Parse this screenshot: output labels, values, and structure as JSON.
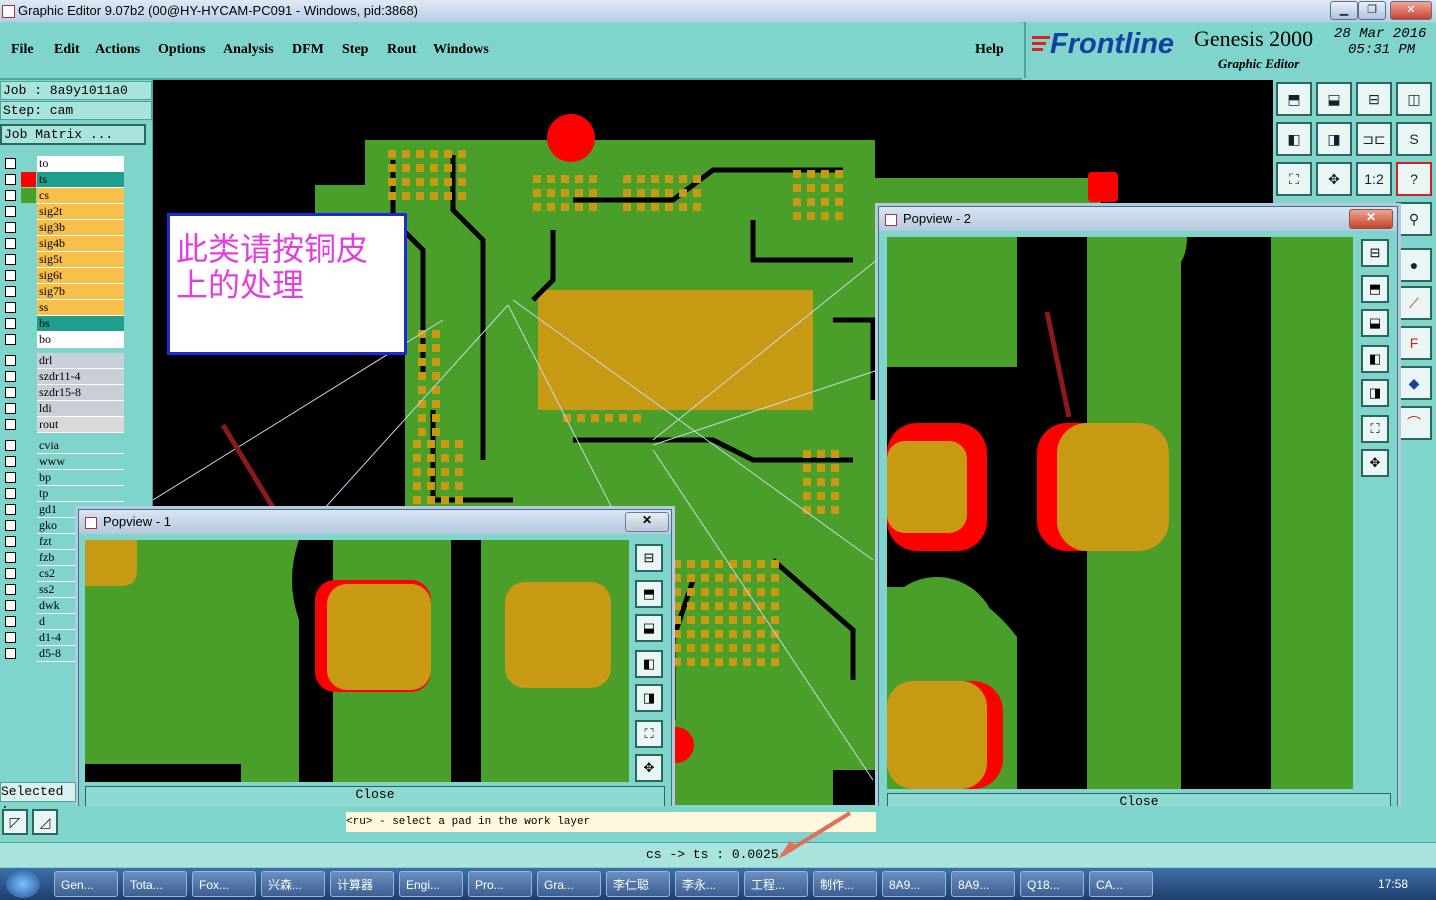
{
  "window": {
    "title": "Graphic Editor 9.07b2 (00@HY-HYCAM-PC091 - Windows, pid:3868)",
    "min": "▁",
    "max": "❐",
    "close": "✕"
  },
  "menu": {
    "items": [
      "File",
      "Edit",
      "Actions",
      "Options",
      "Analysis",
      "DFM",
      "Step",
      "Rout",
      "Windows"
    ],
    "help": "Help"
  },
  "brand": {
    "logo": "Frontline",
    "product": "Genesis 2000",
    "subtitle": "Graphic Editor",
    "date": "28 Mar 2016",
    "time": "05:31 PM"
  },
  "job": {
    "job_label": "Job : 8a9y1011a0",
    "step_label": "Step: cam",
    "matrix_button": "Job Matrix ..."
  },
  "layers": {
    "group1": [
      {
        "name": "to",
        "color": "#ffffff",
        "swatch": "#7fd4cc"
      },
      {
        "name": "ts",
        "color": "#1f9e8e",
        "swatch": "#ff0000",
        "active": true
      },
      {
        "name": "cs",
        "color": "#f6c04a",
        "swatch": "#4a9e2a"
      },
      {
        "name": "sig2t",
        "color": "#f6c04a",
        "swatch": "#7fd4cc"
      },
      {
        "name": "sig3b",
        "color": "#f6c04a",
        "swatch": "#7fd4cc"
      },
      {
        "name": "sig4b",
        "color": "#f6c04a",
        "swatch": "#7fd4cc"
      },
      {
        "name": "sig5t",
        "color": "#f6c04a",
        "swatch": "#7fd4cc"
      },
      {
        "name": "sig6t",
        "color": "#f6c04a",
        "swatch": "#7fd4cc"
      },
      {
        "name": "sig7b",
        "color": "#f6c04a",
        "swatch": "#7fd4cc"
      },
      {
        "name": "ss",
        "color": "#f6c04a",
        "swatch": "#7fd4cc"
      },
      {
        "name": "bs",
        "color": "#1f9e8e",
        "swatch": "#7fd4cc"
      },
      {
        "name": "bo",
        "color": "#ffffff",
        "swatch": "#7fd4cc"
      }
    ],
    "group2": [
      {
        "name": "drl",
        "color": "#c8cfd6"
      },
      {
        "name": "szdr11-4",
        "color": "#c8cfd6"
      },
      {
        "name": "szdr15-8",
        "color": "#c8cfd6"
      },
      {
        "name": "ldi",
        "color": "#c8cfd6"
      },
      {
        "name": "rout",
        "color": "#d9d9d9"
      }
    ],
    "group3": [
      {
        "name": "cvia",
        "color": "#7fd4cc"
      },
      {
        "name": "www",
        "color": "#7fd4cc"
      },
      {
        "name": "bp",
        "color": "#7fd4cc"
      },
      {
        "name": "tp",
        "color": "#7fd4cc"
      },
      {
        "name": "gd1",
        "color": "#7fd4cc"
      },
      {
        "name": "gko",
        "color": "#7fd4cc"
      },
      {
        "name": "fzt",
        "color": "#7fd4cc"
      },
      {
        "name": "fzb",
        "color": "#7fd4cc"
      },
      {
        "name": "cs2",
        "color": "#7fd4cc"
      },
      {
        "name": "ss2",
        "color": "#7fd4cc"
      },
      {
        "name": "dwk",
        "color": "#7fd4cc"
      },
      {
        "name": "d",
        "color": "#7fd4cc"
      },
      {
        "name": "d1-4",
        "color": "#7fd4cc"
      },
      {
        "name": "d5-8",
        "color": "#7fd4cc"
      }
    ]
  },
  "annotation": {
    "text_line1": "此类请按铜皮",
    "text_line2": "上的处理"
  },
  "popview1": {
    "title": "Popview - 1",
    "close_label": "Close"
  },
  "popview2": {
    "title": "Popview - 2",
    "close_label": "Close"
  },
  "status": {
    "selected_label": "Selected :",
    "prompt": "<ru> - select a pad in the work layer",
    "measurement": "cs -> ts : 0.0025"
  },
  "colors": {
    "copper": "#c89a14",
    "board": "#4a9e2a",
    "mask": "#ff0000",
    "panel": "#7fd4cc"
  },
  "taskbar": {
    "items": [
      "Gen...",
      "Tota...",
      "Fox...",
      "兴森...",
      "计算器",
      "Engi...",
      "Pro...",
      "Gra...",
      "李仁聪",
      "李永...",
      "工程...",
      "制作...",
      "8A9...",
      "8A9...",
      "Q18...",
      "CA..."
    ],
    "clock": "17:58"
  },
  "tools": {
    "scale_label": "1:2",
    "help_label": "?"
  }
}
